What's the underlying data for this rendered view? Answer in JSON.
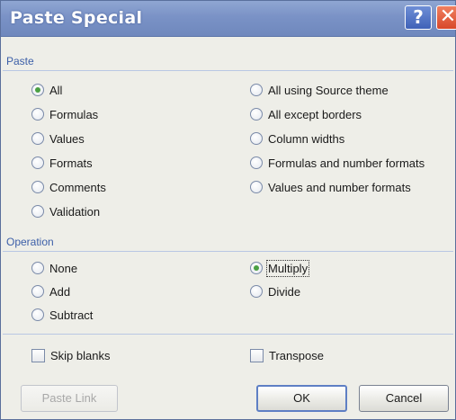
{
  "window": {
    "title": "Paste Special"
  },
  "titlebar": {
    "help_symbol": "?",
    "close_symbol": "✕"
  },
  "paste_section": {
    "label": "Paste",
    "options_left": [
      {
        "label": "All",
        "checked": true
      },
      {
        "label": "Formulas",
        "checked": false
      },
      {
        "label": "Values",
        "checked": false
      },
      {
        "label": "Formats",
        "checked": false
      },
      {
        "label": "Comments",
        "checked": false
      },
      {
        "label": "Validation",
        "checked": false
      }
    ],
    "options_right": [
      {
        "label": "All using Source theme",
        "checked": false
      },
      {
        "label": "All except borders",
        "checked": false
      },
      {
        "label": "Column widths",
        "checked": false
      },
      {
        "label": "Formulas and number formats",
        "checked": false
      },
      {
        "label": "Values and number formats",
        "checked": false
      }
    ]
  },
  "operation_section": {
    "label": "Operation",
    "options_left": [
      {
        "label": "None",
        "checked": false
      },
      {
        "label": "Add",
        "checked": false
      },
      {
        "label": "Subtract",
        "checked": false
      }
    ],
    "options_right": [
      {
        "label": "Multiply",
        "checked": true
      },
      {
        "label": "Divide",
        "checked": false
      }
    ]
  },
  "checkboxes": {
    "skip_blanks": {
      "label": "Skip blanks",
      "checked": false
    },
    "transpose": {
      "label": "Transpose",
      "checked": false
    }
  },
  "buttons": {
    "paste_link": "Paste Link",
    "ok": "OK",
    "cancel": "Cancel"
  },
  "colors": {
    "titlebar": "#7a92c6",
    "section_label": "#3c5fa8",
    "radio_selected": "#4aa043",
    "close_button": "#d8482a"
  }
}
